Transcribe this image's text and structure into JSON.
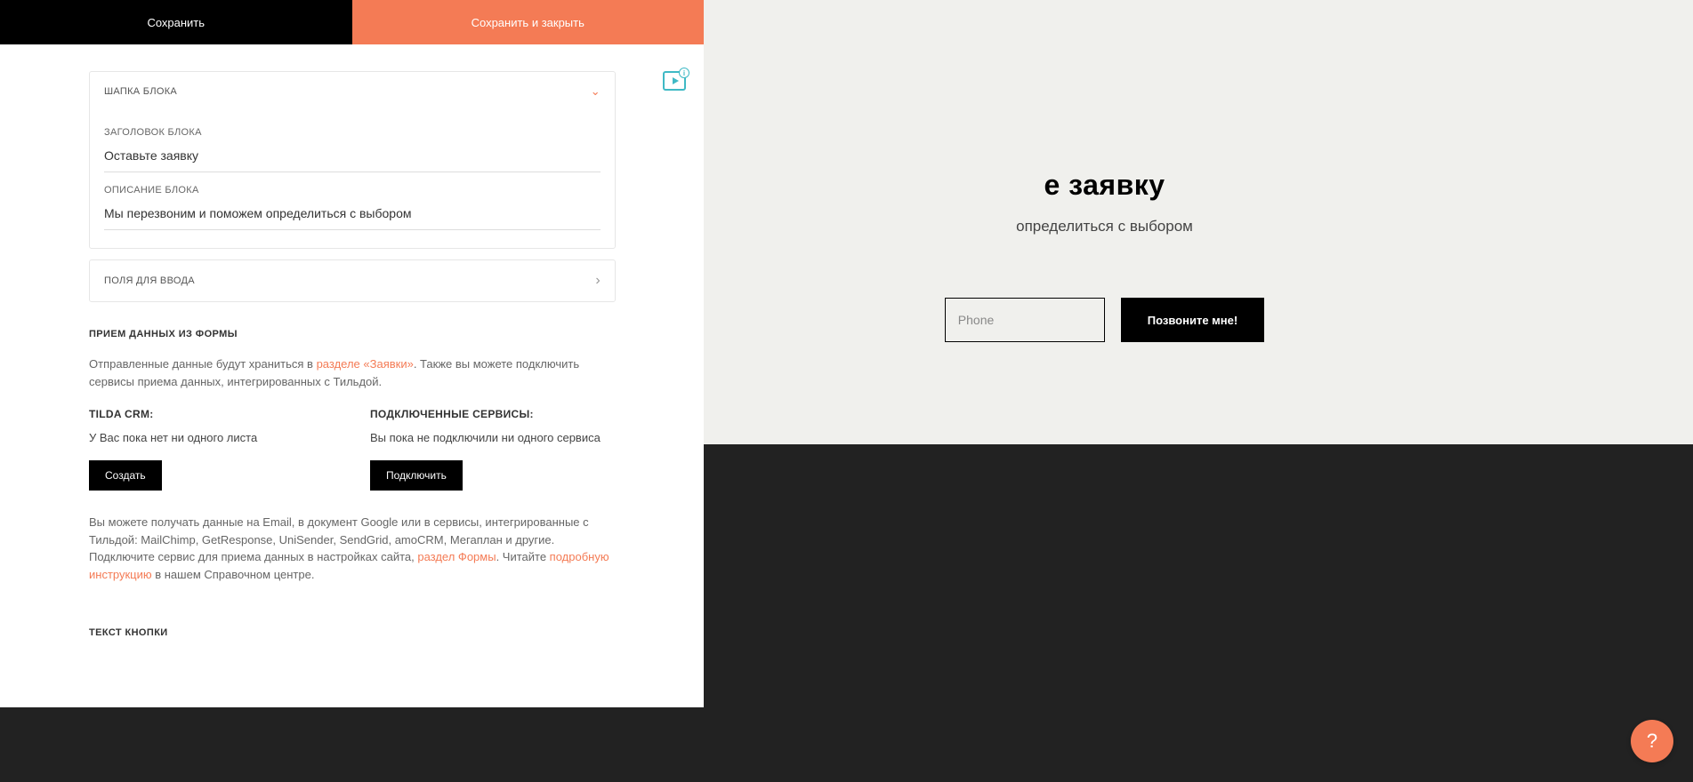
{
  "topbar": {
    "save": "Сохранить",
    "save_close": "Сохранить и закрыть"
  },
  "editor": {
    "header_card": {
      "title": "ШАПКА БЛОКА",
      "field_title_label": "ЗАГОЛОВОК БЛОКА",
      "field_title_value": "Оставьте заявку",
      "field_desc_label": "ОПИСАНИЕ БЛОКА",
      "field_desc_value": "Мы перезвоним и поможем определиться с выбором"
    },
    "inputs_card": {
      "title": "ПОЛЯ ДЛЯ ВВОДА"
    },
    "data_section": {
      "heading": "ПРИЕМ ДАННЫХ ИЗ ФОРМЫ",
      "text_1a": "Отправленные данные будут храниться в ",
      "link_zayavki": "разделе «Заявки»",
      "text_1b": ". Также вы можете подключить сервисы приема данных, интегрированных с Тильдой.",
      "crm_title": "TILDA CRM:",
      "crm_text": "У Вас пока нет ни одного листа",
      "crm_btn": "Создать",
      "services_title": "ПОДКЛЮЧЕННЫЕ СЕРВИСЫ:",
      "services_text": "Вы пока не подключили ни одного сервиса",
      "services_btn": "Подключить",
      "text_2a": "Вы можете получать данные на Email, в документ Google или в сервисы, интегрированные с Тильдой: MailChimp, GetResponse, UniSender, SendGrid, amoCRM, Мегаплан и другие. Подключите сервис для приема данных в настройках сайта, ",
      "link_forms": "раздел Формы",
      "text_2b": ". Читайте ",
      "link_instruction": "подробную инструкцию",
      "text_2c": " в нашем Справочном центре."
    },
    "button_text_heading": "ТЕКСТ КНОПКИ"
  },
  "preview": {
    "title_visible": "е заявку",
    "desc_visible": "определиться с выбором",
    "phone_placeholder": "Phone",
    "call_btn": "Позвоните мне!"
  },
  "help": "?"
}
